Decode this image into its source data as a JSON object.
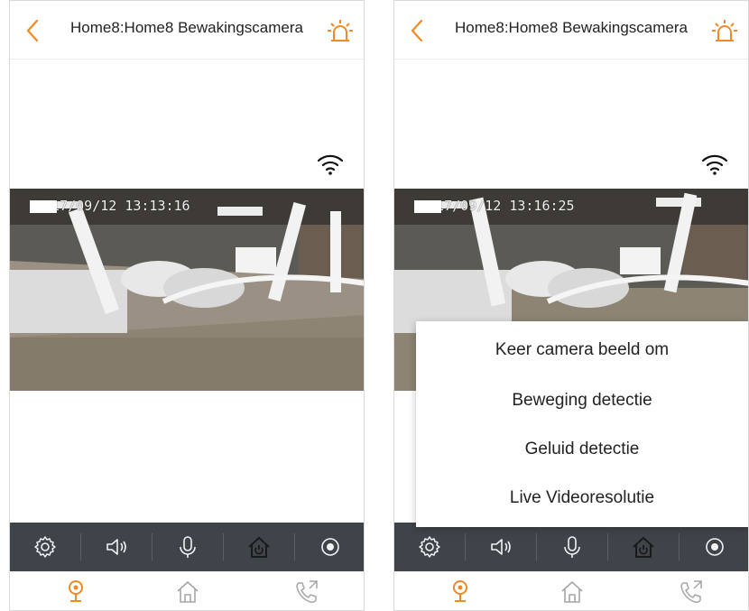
{
  "screens": [
    {
      "header": {
        "title": "Home8:Home8 Bewakingscamera"
      },
      "video": {
        "timestamp": "2017/09/12 13:13:16"
      }
    },
    {
      "header": {
        "title": "Home8:Home8 Bewakingscamera"
      },
      "video": {
        "timestamp": "2017/09/12 13:16:25"
      },
      "menu": {
        "items": [
          {
            "label": "Keer camera beeld om"
          },
          {
            "label": "Beweging detectie"
          },
          {
            "label": "Geluid detectie"
          },
          {
            "label": "Live Videoresolutie"
          }
        ]
      }
    }
  ],
  "toolbar": {
    "items": [
      {
        "icon": "gear-icon"
      },
      {
        "icon": "speaker-icon"
      },
      {
        "icon": "microphone-icon"
      },
      {
        "icon": "home-power-icon"
      },
      {
        "icon": "record-icon"
      }
    ]
  },
  "tabbar": {
    "items": [
      {
        "icon": "camera-tab-icon",
        "active": true
      },
      {
        "icon": "home-tab-icon",
        "active": false
      },
      {
        "icon": "phone-tab-icon",
        "active": false
      }
    ]
  },
  "colors": {
    "accent": "#f08a24",
    "toolbar_bg": "#3f444b",
    "toolbar_icon": "#f2f2f2",
    "active_tool": "#1a1a1a",
    "inactive_tab": "#a6a6a6"
  }
}
